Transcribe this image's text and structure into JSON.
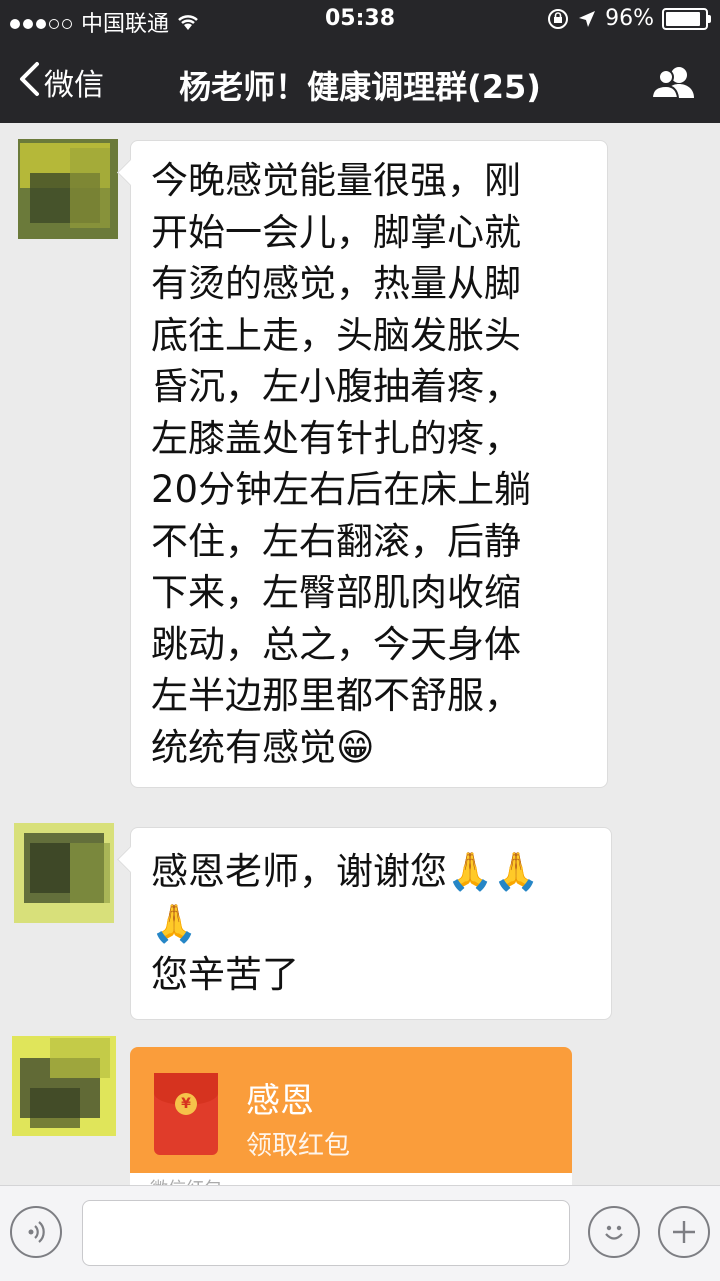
{
  "status_bar": {
    "carrier": "中国联通",
    "time": "05:38",
    "battery": "96%"
  },
  "nav": {
    "back_label": "微信",
    "title": "杨老师！健康调理群(25)"
  },
  "messages": [
    {
      "type": "text",
      "lines": [
        "今晚感觉能量很强，刚",
        "开始一会儿，脚掌心就",
        "有烫的感觉，热量从脚",
        "底往上走，头脑发胀头",
        "昏沉，左小腹抽着疼，",
        "左膝盖处有针扎的疼，",
        "20分钟左右后在床上躺",
        "不住，左右翻滚，后静",
        "下来，左臀部肌肉收缩",
        "跳动，总之，今天身体",
        "左半边那里都不舒服，",
        "统统有感觉😁"
      ]
    },
    {
      "type": "text",
      "lines": [
        "感恩老师，谢谢您🙏🙏",
        "🙏",
        "您辛苦了"
      ]
    },
    {
      "type": "red_packet",
      "title": "感恩",
      "subtitle": "领取红包",
      "footer": "微信红包"
    }
  ],
  "input_bar": {
    "placeholder": ""
  },
  "colors": {
    "nav_bg": "#262629",
    "chat_bg": "#ebebeb",
    "red_packet": "#fa9d3b"
  }
}
